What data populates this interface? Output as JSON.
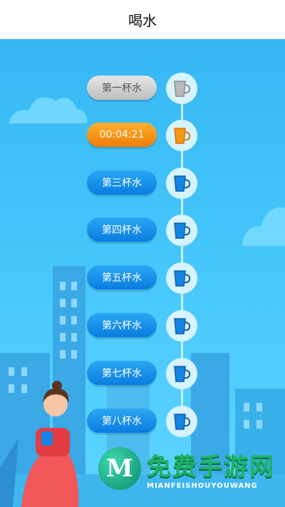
{
  "header": {
    "title": "喝水"
  },
  "cups": [
    {
      "label": "第一杯水",
      "state": "done",
      "color": "#b9b9b9"
    },
    {
      "label": "00:04:21",
      "state": "current",
      "color": "#f5951a"
    },
    {
      "label": "第三杯水",
      "state": "pending",
      "color": "#1584e2"
    },
    {
      "label": "第四杯水",
      "state": "pending",
      "color": "#1584e2"
    },
    {
      "label": "第五杯水",
      "state": "pending",
      "color": "#1584e2"
    },
    {
      "label": "第六杯水",
      "state": "pending",
      "color": "#1584e2"
    },
    {
      "label": "第七杯水",
      "state": "pending",
      "color": "#1584e2"
    },
    {
      "label": "第八杯水",
      "state": "pending",
      "color": "#1584e2"
    }
  ],
  "watermark": {
    "mark": "M",
    "cn": "免费手游网",
    "en": "MIANFEISHOUYOUWANG"
  },
  "colors": {
    "sky": "#45c6fb",
    "done": "#bdbdbd",
    "current": "#f07b06",
    "pending": "#0a7ce0"
  },
  "icons": {
    "cup": "cup-icon"
  }
}
